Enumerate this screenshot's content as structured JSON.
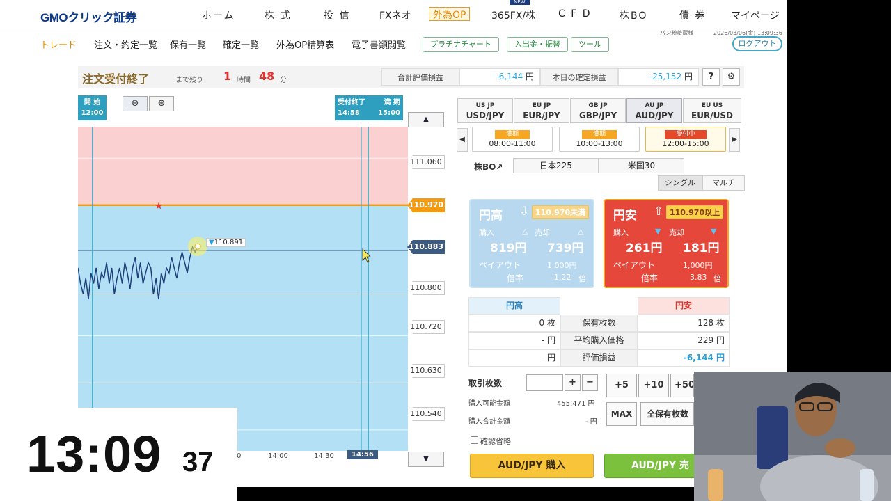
{
  "topnav": {
    "logo": "GMOクリック証券",
    "new_badge": "NEW",
    "items": [
      "ホーム",
      "株 式",
      "投 信",
      "FXネオ",
      "外為OP",
      "365FX/株",
      "C F D",
      "株BO",
      "債 券",
      "マイページ"
    ]
  },
  "subnav": {
    "items": [
      "トレード",
      "注文・約定一覧",
      "保有一覧",
      "確定一覧",
      "外為OP精算表",
      "電子書類閲覧"
    ],
    "buttons": [
      "プラチナチャート",
      "入出金・振替",
      "ツール"
    ],
    "user": "パン粉羞蔵様",
    "datetime": "2026/03/06(金) 13:09:36",
    "logout": "ログアウト"
  },
  "status": {
    "title": "注文受付終了",
    "remaining_label": "まで残り",
    "hours": "1",
    "hours_unit": "時間",
    "minutes": "48",
    "minutes_unit": "分",
    "eval_label": "合計評価損益",
    "eval_value": "-6,144",
    "today_label": "本日の確定損益",
    "today_value": "-25,152",
    "yen": "円",
    "help": "?",
    "settings_icon": "gear-icon"
  },
  "chart": {
    "start_label": "開 始",
    "start_time": "12:00",
    "close_label": "受付終了",
    "close_time": "14:58",
    "expiry_label": "満 期",
    "expiry_time": "15:00",
    "current_time_label": "14:56",
    "time_ticks": [
      "14:00",
      "14:30"
    ],
    "partial_tick": "0",
    "price_ticks": [
      "111.060",
      "110.800",
      "110.720",
      "110.630",
      "110.540"
    ],
    "target_price": "110.970",
    "current_price": "110.883",
    "marker_price": "110.891",
    "colors": {
      "above": "#fbd0d0",
      "below": "#b3e0f5",
      "target_line": "#f39c12",
      "line": "#1f3f7a"
    }
  },
  "chart_data": {
    "type": "line",
    "ylim": [
      110.5,
      111.12
    ],
    "target": 110.97,
    "current": 110.883,
    "series": [
      {
        "values": [
          110.85,
          110.82,
          110.8,
          110.83,
          110.79,
          110.84,
          110.82,
          110.85,
          110.81,
          110.84,
          110.83,
          110.86,
          110.82,
          110.85,
          110.8,
          110.83,
          110.85,
          110.82,
          110.86,
          110.84,
          110.81,
          110.85,
          110.87,
          110.83,
          110.86,
          110.82,
          110.84,
          110.86,
          110.85,
          110.8,
          110.83,
          110.79,
          110.84,
          110.82,
          110.85,
          110.84,
          110.87,
          110.85,
          110.83,
          110.86,
          110.88,
          110.86,
          110.84,
          110.87,
          110.89,
          110.88,
          110.891
        ]
      }
    ]
  },
  "trade": {
    "pairs": [
      {
        "label": "USD/JPY",
        "flags": "US JP"
      },
      {
        "label": "EUR/JPY",
        "flags": "EU JP"
      },
      {
        "label": "GBP/JPY",
        "flags": "GB JP"
      },
      {
        "label": "AUD/JPY",
        "flags": "AU JP"
      },
      {
        "label": "EUR/USD",
        "flags": "EU US"
      }
    ],
    "slots": [
      {
        "status": "満期",
        "time": "08:00-11:00"
      },
      {
        "status": "満期",
        "time": "10:00-13:00"
      },
      {
        "status": "受付中",
        "time": "12:00-15:00"
      }
    ],
    "bo_label": "株BO",
    "bo_tabs": [
      "日本225",
      "米国30"
    ],
    "modes": [
      "シングル",
      "マルチ"
    ],
    "high": {
      "label": "円高",
      "cond": "110.970未満",
      "buy_label": "購入",
      "sell_label": "売却",
      "buy": "819",
      "sell": "739",
      "yen": "円",
      "payout_label": "ペイアウト",
      "payout": "1,000",
      "mult_label": "倍率",
      "mult": "1.22"
    },
    "low": {
      "label": "円安",
      "cond": "110.970以上",
      "buy_label": "購入",
      "sell_label": "売却",
      "buy": "261",
      "sell": "181",
      "yen": "円",
      "payout_label": "ペイアウト",
      "payout": "1,000",
      "mult_label": "倍率",
      "mult": "3.83"
    },
    "positions": {
      "col_high": "円高",
      "col_low": "円安",
      "rows": [
        {
          "label": "保有枚数",
          "high": "0 枚",
          "low": "128 枚"
        },
        {
          "label": "平均購入価格",
          "high": "- 円",
          "low": "229 円"
        },
        {
          "label": "評価損益",
          "high": "- 円",
          "low": "-6,144 円"
        }
      ]
    },
    "order": {
      "qty_label": "取引枚数",
      "qty_value": "",
      "plus": "+",
      "minus": "−",
      "quick": [
        "+5",
        "+10",
        "+50"
      ],
      "max": "MAX",
      "all_hold": "全保有枚数",
      "avail_label": "購入可能金額",
      "avail_value": "455,471 円",
      "total_label": "購入合計金額",
      "total_value": "- 円",
      "confirm_skip": "確認省略",
      "buy_button": "AUD/JPY 購入",
      "sell_button": "AUD/JPY 売"
    }
  },
  "clock": {
    "hm": "13:09",
    "sec": "37"
  }
}
